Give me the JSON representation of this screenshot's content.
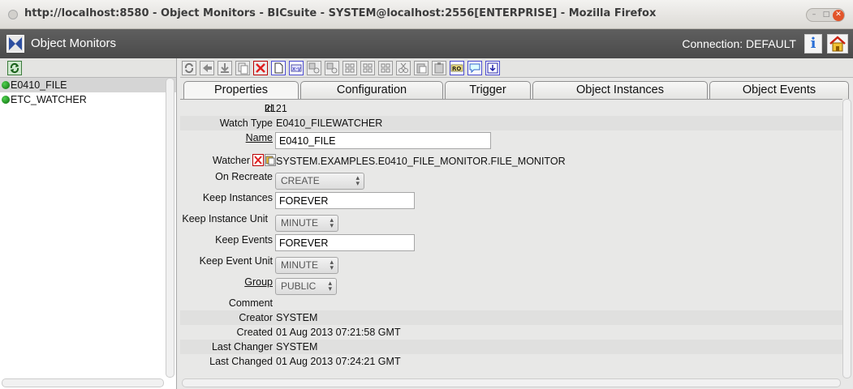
{
  "window": {
    "title": "http://localhost:8580 - Object Monitors - BICsuite - SYSTEM@localhost:2556[ENTERPRISE] - Mozilla Firefox"
  },
  "app": {
    "title": "Object Monitors",
    "connection": "Connection: DEFAULT"
  },
  "monitors": [
    {
      "name": "E0410_FILE",
      "status": "green",
      "selected": true
    },
    {
      "name": "ETC_WATCHER",
      "status": "green",
      "selected": false
    }
  ],
  "tabs": [
    {
      "label": "Properties",
      "active": true
    },
    {
      "label": "Configuration",
      "active": false
    },
    {
      "label": "Trigger",
      "active": false
    },
    {
      "label": "Object Instances",
      "active": false
    },
    {
      "label": "Object Events",
      "active": false
    }
  ],
  "properties": {
    "id_label": "Id",
    "id_value": "2121",
    "watch_type_label": "Watch Type",
    "watch_type_value": "E0410_FILEWATCHER",
    "name_label": "Name",
    "name_value": "E0410_FILE",
    "watcher_label": "Watcher",
    "watcher_value": "SYSTEM.EXAMPLES.E0410_FILE_MONITOR.FILE_MONITOR",
    "on_recreate_label": "On Recreate",
    "on_recreate_value": "CREATE",
    "keep_instances_label": "Keep Instances",
    "keep_instances_value": "FOREVER",
    "keep_instance_unit_label": "Keep Instance Unit",
    "keep_instance_unit_value": "MINUTE",
    "keep_events_label": "Keep Events",
    "keep_events_value": "FOREVER",
    "keep_event_unit_label": "Keep Event Unit",
    "keep_event_unit_value": "MINUTE",
    "group_label": "Group",
    "group_value": "PUBLIC",
    "comment_label": "Comment",
    "comment_value": "",
    "creator_label": "Creator",
    "creator_value": "SYSTEM",
    "created_label": "Created",
    "created_value": "01 Aug 2013 07:21:58 GMT",
    "last_changer_label": "Last Changer",
    "last_changer_value": "SYSTEM",
    "last_changed_label": "Last Changed",
    "last_changed_value": "01 Aug 2013 07:24:21 GMT"
  },
  "toolbar_icons": [
    "refresh-icon",
    "back-icon",
    "save-icon",
    "copy-icon",
    "delete-icon",
    "new-icon",
    "xy-icon",
    "new-child-icon",
    "new-sibling-icon",
    "grid-icon",
    "grid2-icon",
    "grid3-icon",
    "cut-icon",
    "paste-icon",
    "clipboard-icon",
    "ro-icon",
    "comment-icon",
    "download-icon"
  ],
  "colors": {
    "header_bg": "#525252",
    "active_led": "#1f9a1f",
    "delete_red": "#e02020"
  }
}
